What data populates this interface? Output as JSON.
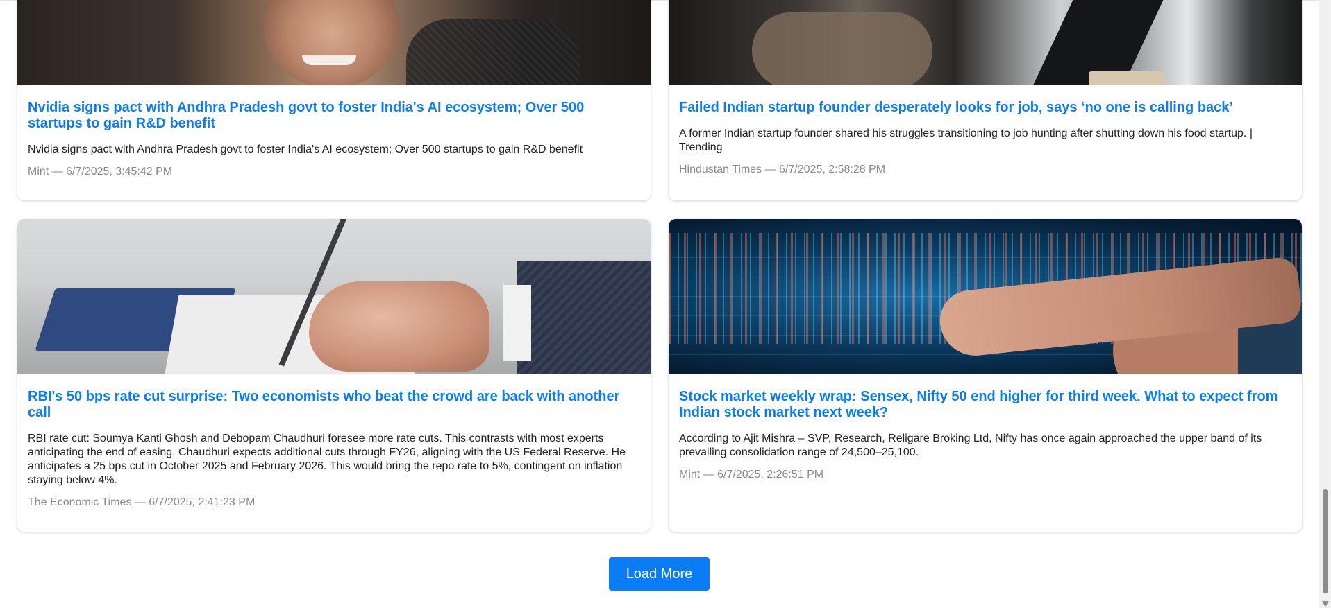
{
  "articles": [
    {
      "title": "Nvidia signs pact with Andhra Pradesh govt to foster India's AI ecosystem; Over 500 startups to gain R&D benefit",
      "description": "Nvidia signs pact with Andhra Pradesh govt to foster India's AI ecosystem; Over 500 startups to gain R&D benefit",
      "meta": "Mint — 6/7/2025, 3:45:42 PM",
      "image": "portrait-photo"
    },
    {
      "title": "Failed Indian startup founder desperately looks for job, says ‘no one is calling back’",
      "description": "A former Indian startup founder shared his struggles transitioning to job hunting after shutting down his food startup. | Trending",
      "meta": "Hindustan Times — 6/7/2025, 2:58:28 PM",
      "image": "office-photo"
    },
    {
      "title": "RBI's 50 bps rate cut surprise: Two economists who beat the crowd are back with another call",
      "description": "RBI rate cut: Soumya Kanti Ghosh and Debopam Chaudhuri foresee more rate cuts. This contrasts with most experts anticipating the end of easing. Chaudhuri expects additional cuts through FY26, aligning with the US Federal Reserve. He anticipates a 25 bps cut in October 2025 and February 2026. This would bring the repo rate to 5%, contingent on inflation staying below 4%.",
      "meta": "The Economic Times — 6/7/2025, 2:41:23 PM",
      "image": "pen-notebook-photo"
    },
    {
      "title": "Stock market weekly wrap: Sensex, Nifty 50 end higher for third week. What to expect from Indian stock market next week?",
      "description": "According to Ajit Mishra – SVP, Research, Religare Broking Ltd, Nifty has once again approached the upper band of its prevailing consolidation range of 24,500–25,100.",
      "meta": "Mint — 6/7/2025, 2:26:51 PM",
      "image": "stock-chart-photo"
    }
  ],
  "load_more_label": "Load More",
  "colors": {
    "accent": "#0a7cf5",
    "meta_text": "#8a8a8a",
    "body_text": "#222222"
  }
}
